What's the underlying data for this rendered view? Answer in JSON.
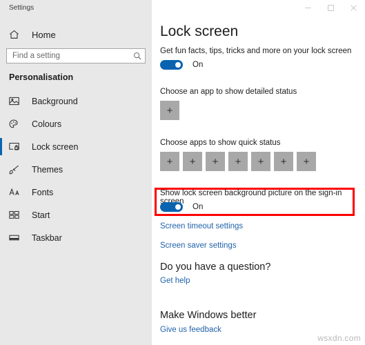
{
  "window": {
    "app_title": "Settings",
    "controls": [
      {
        "name": "minimize",
        "label": "–"
      },
      {
        "name": "maximize",
        "label": "□"
      },
      {
        "name": "close",
        "label": "✕"
      }
    ]
  },
  "sidebar": {
    "home_label": "Home",
    "search": {
      "placeholder": "Find a setting",
      "value": "",
      "icon": "search-icon"
    },
    "section_label": "Personalisation",
    "items": [
      {
        "label": "Background",
        "icon": "image-icon",
        "selected": false
      },
      {
        "label": "Colours",
        "icon": "palette-icon",
        "selected": false
      },
      {
        "label": "Lock screen",
        "icon": "lock-screen-icon",
        "selected": true
      },
      {
        "label": "Themes",
        "icon": "themes-brush-icon",
        "selected": false
      },
      {
        "label": "Fonts",
        "icon": "fonts-aa-icon",
        "selected": false
      },
      {
        "label": "Start",
        "icon": "start-grid-icon",
        "selected": false
      },
      {
        "label": "Taskbar",
        "icon": "taskbar-icon",
        "selected": false
      }
    ]
  },
  "main": {
    "page_title": "Lock screen",
    "fun_facts": {
      "label": "Get fun facts, tips, tricks and more on your lock screen",
      "toggle_state": "On"
    },
    "detailed_status": {
      "label": "Choose an app to show detailed status",
      "tile_glyph": "+"
    },
    "quick_status": {
      "label": "Choose apps to show quick status",
      "tile_glyph": "+",
      "tile_count": 7
    },
    "signin_background": {
      "label": "Show lock screen background picture on the sign-in screen",
      "toggle_state": "On",
      "highlight_color": "#ff0000"
    },
    "links": {
      "screen_timeout": "Screen timeout settings",
      "screen_saver": "Screen saver settings",
      "get_help": "Get help",
      "give_feedback": "Give us feedback"
    },
    "headings": {
      "question": "Do you have a question?",
      "better": "Make Windows better"
    }
  },
  "watermark": "wsxdn.com",
  "colors": {
    "accent": "#0a63b0",
    "link": "#2162a8",
    "sidebar_bg": "#e8e8e8",
    "tile": "#a8a8a8"
  }
}
